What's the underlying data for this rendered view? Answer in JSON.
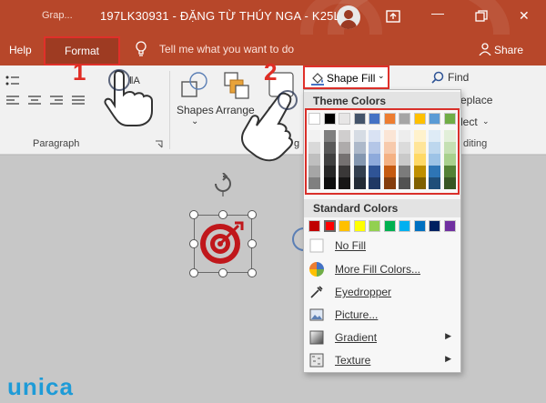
{
  "title_bar": {
    "tab_stub": "Grap...",
    "document_title": "197LK30931 - ĐẶNG TỪ THÚY NGA - K25LK1",
    "minimize_glyph": "—",
    "close_glyph": "✕"
  },
  "tabs": {
    "help": "Help",
    "format": "Format",
    "tell_me": "Tell me what you want to do",
    "share": "Share"
  },
  "ribbon": {
    "shapes_label": "Shapes",
    "arrange_label": "Arrange",
    "find_label": "Find",
    "replace_label": "eplace",
    "select_label": "lect",
    "editing_label": "diting",
    "paragraph_label": "Paragraph",
    "shape_fill_label": "Shape Fill",
    "shapes_chevron": "⌄",
    "quick_styles_stub": "Q",
    "drawing_stub": "g"
  },
  "steps": {
    "one": "1",
    "two": "2"
  },
  "menu": {
    "theme_colors_label": "Theme Colors",
    "standard_colors_label": "Standard Colors",
    "items": [
      {
        "label": "No Fill",
        "icon": "no-fill-icon"
      },
      {
        "label": "More Fill Colors...",
        "icon": "color-wheel-icon"
      },
      {
        "label": "Eyedropper",
        "icon": "eyedropper-icon"
      },
      {
        "label": "Picture...",
        "icon": "picture-icon"
      },
      {
        "label": "Gradient",
        "icon": "gradient-icon",
        "submenu": true
      },
      {
        "label": "Texture",
        "icon": "texture-icon",
        "submenu": true
      }
    ],
    "theme_top_row": [
      "#ffffff",
      "#000000",
      "#e7e6e6",
      "#44546a",
      "#4472c4",
      "#ed7d31",
      "#a5a5a5",
      "#ffc000",
      "#5b9bd5",
      "#70ad47"
    ],
    "theme_shades": [
      [
        "#f2f2f2",
        "#d9d9d9",
        "#bfbfbf",
        "#a6a6a6",
        "#808080"
      ],
      [
        "#7f7f7f",
        "#595959",
        "#404040",
        "#262626",
        "#0d0d0d"
      ],
      [
        "#d0cece",
        "#aeabab",
        "#757171",
        "#3a3838",
        "#171616"
      ],
      [
        "#d6dce4",
        "#adb9ca",
        "#8497b0",
        "#333f4f",
        "#222a35"
      ],
      [
        "#d9e2f3",
        "#b4c6e7",
        "#8eaadb",
        "#2f5496",
        "#1f3864"
      ],
      [
        "#fbe5d5",
        "#f7caac",
        "#f4b183",
        "#c55a11",
        "#843c0c"
      ],
      [
        "#ededed",
        "#dbdbdb",
        "#c9c9c9",
        "#7b7b7b",
        "#525252"
      ],
      [
        "#fff2cc",
        "#ffe599",
        "#ffd966",
        "#bf8f00",
        "#7f6000"
      ],
      [
        "#deebf6",
        "#bdd7ee",
        "#9dc3e6",
        "#2e75b5",
        "#1f4e79"
      ],
      [
        "#e2efd9",
        "#c5e0b3",
        "#a8d08d",
        "#538135",
        "#375623"
      ]
    ],
    "standard_colors": [
      "#c00000",
      "#ff0000",
      "#ffc000",
      "#ffff00",
      "#92d050",
      "#00b050",
      "#00b0f0",
      "#0070c0",
      "#002060",
      "#7030a0"
    ]
  },
  "logo": "unica",
  "colors": {
    "accent": "#b7472a",
    "highlight": "#e0302a"
  }
}
